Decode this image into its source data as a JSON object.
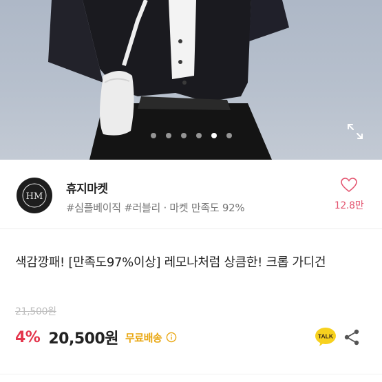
{
  "hero": {
    "image_description_icon": "product-photo",
    "carousel": {
      "total": 6,
      "active": 4
    },
    "expand_icon": "expand-icon"
  },
  "seller": {
    "avatar_monogram": "HM",
    "name": "휴지마켓",
    "tags": "#심플베이직 #러블리 · 마켓 만족도 92%",
    "like_count": "12.8만",
    "like_icon": "heart-icon"
  },
  "product": {
    "title": "색감깡패! [만족도97%이상] 레모나처럼 상큼한! 크롭 가디건",
    "original_price": "21,500원",
    "discount": "4%",
    "price": "20,500원",
    "shipping": "무료배송",
    "talk_label": "TALK"
  },
  "colors": {
    "accent_red": "#e4364d",
    "like_pink": "#e45570",
    "shipping_gold": "#e9a712",
    "talk_yellow": "#f7d11e"
  }
}
